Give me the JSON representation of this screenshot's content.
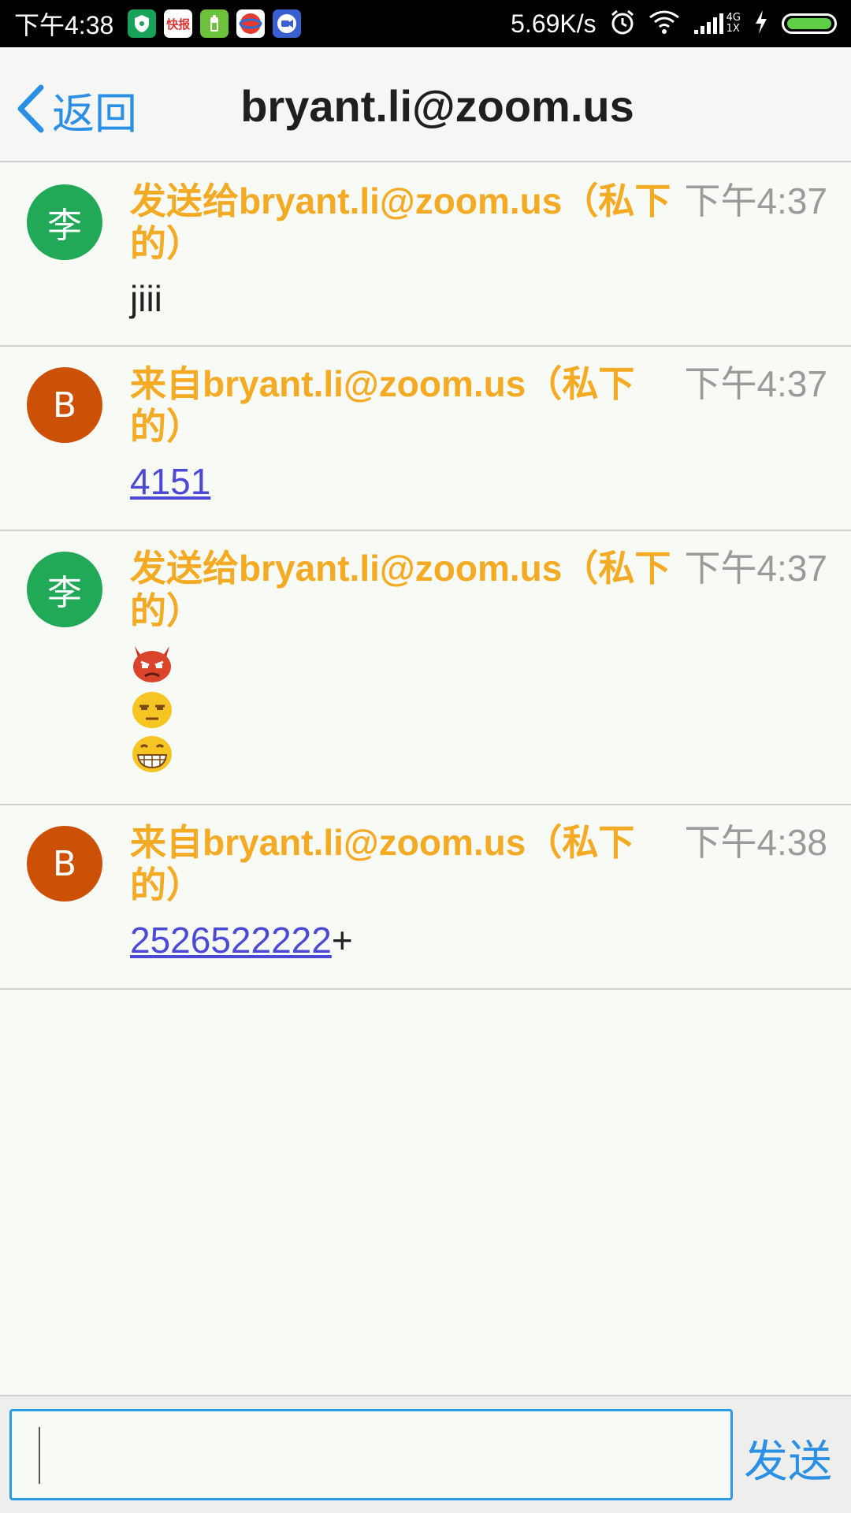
{
  "status_bar": {
    "time": "下午4:38",
    "app_icons": [
      "shield-app-icon",
      "news-app-icon",
      "battery-app-icon",
      "browser-app-icon",
      "zoom-app-icon"
    ],
    "app_icon_labels": {
      "news": "快报"
    },
    "net_speed": "5.69K/s",
    "network_label_top": "4G",
    "network_label_bottom": "1X",
    "battery_level": 1.0
  },
  "header": {
    "back_label": "返回",
    "title": "bryant.li@zoom.us"
  },
  "messages": [
    {
      "avatar_text": "李",
      "avatar_color": "#21a957",
      "sender_line1": "发送给bryant.li@zoom.us（私下",
      "sender_line2": "的）",
      "time": "下午4:37",
      "text": "jiii"
    },
    {
      "avatar_text": "B",
      "avatar_color": "#cc5106",
      "sender_line1": "来自bryant.li@zoom.us（私下",
      "sender_line2": "的）",
      "time": "下午4:37",
      "link_text": "4151"
    },
    {
      "avatar_text": "李",
      "avatar_color": "#21a957",
      "sender_line1": "发送给bryant.li@zoom.us（私下",
      "sender_line2": "的）",
      "time": "下午4:37",
      "emojis": [
        "angry-devil-emoji",
        "unamused-face-emoji",
        "grinning-face-emoji"
      ]
    },
    {
      "avatar_text": "B",
      "avatar_color": "#cc5106",
      "sender_line1": "来自bryant.li@zoom.us（私下",
      "sender_line2": "的）",
      "time": "下午4:38",
      "link_text": "2526522222",
      "suffix": "+"
    }
  ],
  "composer": {
    "input_value": "",
    "send_label": "发送"
  },
  "colors": {
    "accent": "#2a8fe5",
    "sender": "#f5aa23",
    "link": "#4b49d6"
  }
}
